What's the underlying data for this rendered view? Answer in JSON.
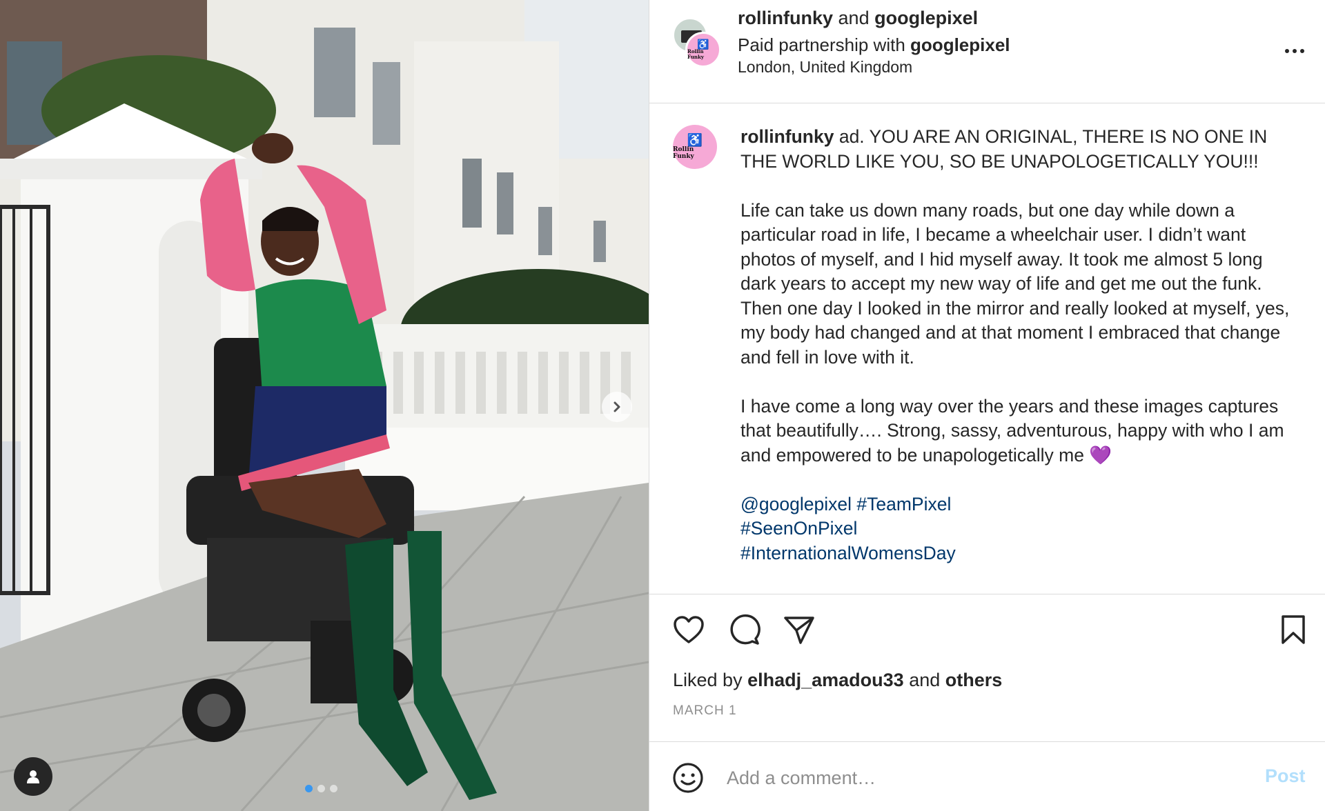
{
  "header": {
    "user1": "rollinfunky",
    "joiner": "and",
    "user2": "googlepixel",
    "partnership_prefix": "Paid partnership with",
    "partner": "googlepixel",
    "location": "London, United Kingdom",
    "avatar_logo_text": "Rollin Funky"
  },
  "post": {
    "username": "rollinfunky",
    "caption_p1": "ad. YOU ARE AN ORIGINAL, THERE IS NO ONE IN THE WORLD LIKE YOU, SO BE UNAPOLOGETICALLY YOU!!!",
    "caption_p2": "Life can take us down many roads, but one day while down a particular road in life, I became a wheelchair user. I didn’t want photos of myself, and I hid myself away. It took me almost 5 long dark years to accept my new way of life and get me out the funk. Then one day I looked in the mirror and really looked at myself, yes, my body had changed and at that moment I embraced that change and fell in love with it.",
    "caption_p3": "I have come a long way over the years and these images captures that beautifully…. Strong, sassy, adventurous, happy with who I am and empowered to be unapologetically me",
    "emoji": "💜",
    "mention": "@googlepixel",
    "tag1": "#TeamPixel",
    "tag2": "#SeenOnPixel",
    "tag3": "#InternationalWomensDay"
  },
  "actions": {
    "liked_by_prefix": "Liked by",
    "liked_user": "elhadj_amadou33",
    "and_text": "and",
    "others": "others",
    "date": "MARCH 1"
  },
  "comment": {
    "placeholder": "Add a comment…",
    "post_label": "Post"
  },
  "icons": [
    "heart-icon",
    "comment-icon",
    "share-icon",
    "bookmark-icon",
    "emoji-icon",
    "more-icon",
    "chevron-right-icon",
    "user-tag-icon"
  ],
  "colors": {
    "link": "#00376b",
    "post_button": "#b2dffc",
    "muted": "#8e8e8e",
    "avatar_pink": "#f6a9d6"
  },
  "carousel": {
    "slides": 3,
    "active": 1
  }
}
